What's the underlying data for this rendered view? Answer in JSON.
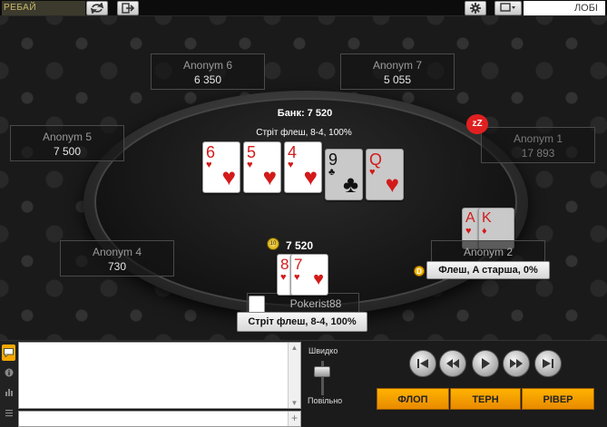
{
  "topbar": {
    "rebuy_label": "РЕБАЙ",
    "lobby_label": "ЛОБІ",
    "icons": [
      "refresh-icon",
      "exit-icon",
      "gear-icon",
      "window-icon"
    ]
  },
  "table": {
    "pot_label": "Банк: 7 520",
    "pot_hand": "Стріт флеш, 8-4, 100%",
    "seats": [
      {
        "name": "Anonym 6",
        "stack": "6 350"
      },
      {
        "name": "Anonym 7",
        "stack": "5 055"
      },
      {
        "name": "Anonym 5",
        "stack": "7 500"
      },
      {
        "name": "Anonym 1",
        "stack": "17 893"
      },
      {
        "name": "Anonym 4",
        "stack": "730"
      },
      {
        "name": "Anonym 2"
      },
      {
        "name": "Pokerist88"
      }
    ],
    "board": [
      {
        "rank": "6",
        "suit": "♥",
        "color": "red"
      },
      {
        "rank": "5",
        "suit": "♥",
        "color": "red"
      },
      {
        "rank": "4",
        "suit": "♥",
        "color": "red"
      },
      {
        "rank": "9",
        "suit": "♣",
        "color": "black"
      },
      {
        "rank": "Q",
        "suit": "♥",
        "color": "red"
      }
    ],
    "anonym2_cards": [
      {
        "rank": "A",
        "suit": "♥"
      },
      {
        "rank": "K",
        "suit": "♦"
      }
    ],
    "hero_cards": [
      {
        "rank": "8",
        "suit": "♥"
      },
      {
        "rank": "7",
        "suit": "♥"
      }
    ],
    "hero_bet": "7 520",
    "anonym2_hand": "Флеш, A старша, 0%",
    "hero_hand": "Стріт флеш, 8-4, 100%",
    "sleep_badge": "zZ",
    "dealer_label": "D",
    "chip_label": "10"
  },
  "bottom": {
    "speed_fast": "Швидко",
    "speed_slow": "Повільно",
    "streets": [
      "ФЛОП",
      "ТЕРН",
      "РІВЕР"
    ]
  },
  "colors": {
    "accent": "#f6a800",
    "red_suit": "#d31a1a"
  }
}
